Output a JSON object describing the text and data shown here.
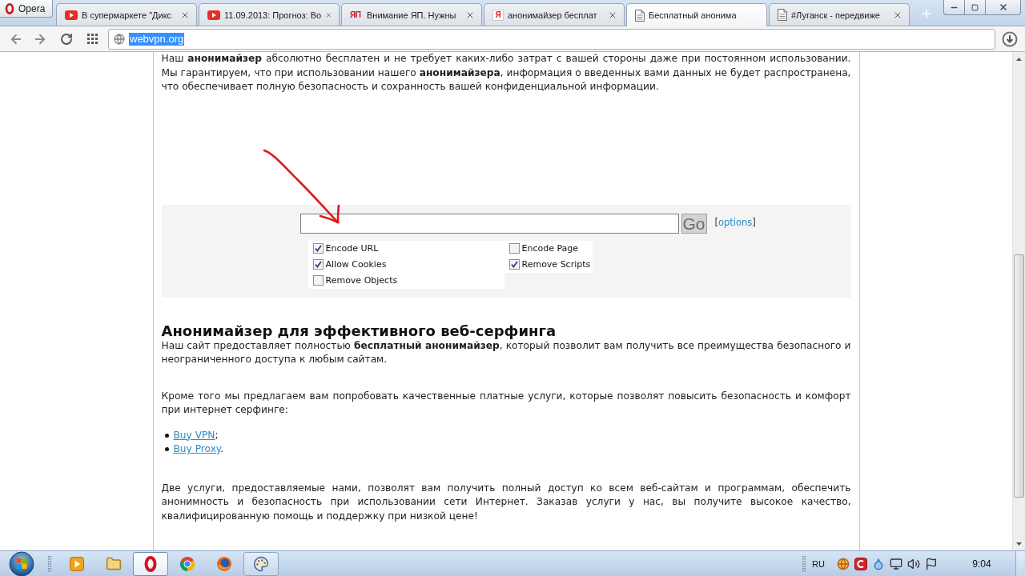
{
  "browser": {
    "menu_button": "Opera",
    "tabs": [
      {
        "title": "В супермаркете \"Дикс",
        "icon": {
          "kind": "youtube"
        },
        "selected": false
      },
      {
        "title": "11.09.2013: Прогноз: Во",
        "icon": {
          "kind": "youtube"
        },
        "selected": false
      },
      {
        "title": "Внимание ЯП. Нужны",
        "icon": {
          "kind": "wordmark",
          "text": "ЯП"
        },
        "selected": false
      },
      {
        "title": "анонимайзер бесплат",
        "icon": {
          "kind": "tile",
          "text": "Я"
        },
        "selected": false
      },
      {
        "title": "Бесплатный анонима",
        "icon": {
          "kind": "page"
        },
        "selected": true
      },
      {
        "title": "#Луганск - передвиже",
        "icon": {
          "kind": "page"
        },
        "selected": false
      }
    ],
    "address_bar": {
      "url": "webvpn.org",
      "url_selected": true
    }
  },
  "page": {
    "intro": "Наш **анонимайзер** абсолютно бесплатен и не требует каких-либо затрат с вашей стороны даже при постоянном использовании. Мы гарантируем, что при использовании нашего **анонимайзера**, информация о введенных вами данных не будет распространена, что обеспечивает полную безопасность и сохранность вашей конфиденциальной информации.",
    "form": {
      "go_button": "Go",
      "options": {
        "open": "[",
        "link": "options",
        "close": "]"
      },
      "option_columns": [
        {
          "options": [
            {
              "label": "Encode URL",
              "checked": true
            },
            {
              "label": "Allow Cookies",
              "checked": true
            },
            {
              "label": "Remove Objects",
              "checked": false
            }
          ]
        },
        {
          "options": [
            {
              "label": "Encode Page",
              "checked": false
            },
            {
              "label": "Remove Scripts",
              "checked": true
            }
          ]
        }
      ]
    },
    "section": {
      "title": "Анонимайзер для эффективного веб-серфинга",
      "blocks": [
        {
          "kind": "paragraph",
          "text": "Наш сайт предоставляет полностью **бесплатный анонимайзер**, который позволит вам получить все преимущества безопасного и неограниченного доступа к любым сайтам."
        },
        {
          "kind": "paragraph",
          "text": "Кроме того мы предлагаем вам попробовать качественные платные услуги, которые позволят повысить безопасность и комфорт при интернет серфинге:"
        },
        {
          "kind": "list",
          "items": [
            {
              "link": "Buy VPN",
              "after": ";"
            },
            {
              "link": "Buy Proxy",
              "after": "."
            }
          ]
        },
        {
          "kind": "paragraph",
          "text": "Две услуги, предоставляемые нами, позволят вам получить полный доступ ко всем веб-сайтам и программам, обеспечить анонимность и безопасность при использовании сети Интернет. Заказав услуги у нас, вы получите высокое качество, квалифицированную помощь и поддержку при низкой цене!"
        }
      ]
    }
  },
  "taskbar": {
    "apps": [
      {
        "kind": "media",
        "selected": false,
        "running": false
      },
      {
        "kind": "folder",
        "selected": false,
        "running": false
      },
      {
        "kind": "opera",
        "selected": true,
        "running": true
      },
      {
        "kind": "chrome",
        "selected": false,
        "running": false
      },
      {
        "kind": "firefox",
        "selected": false,
        "running": false
      },
      {
        "kind": "paint",
        "selected": false,
        "running": true
      }
    ],
    "language": "RU",
    "clock": "9:04"
  }
}
